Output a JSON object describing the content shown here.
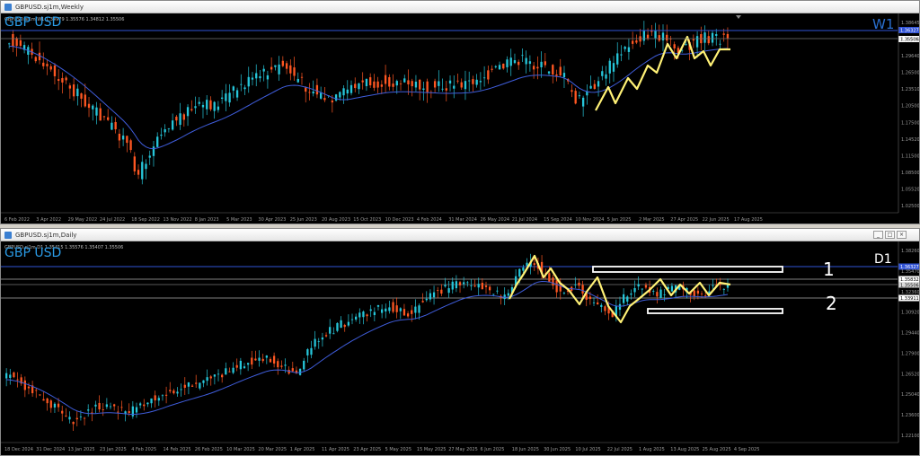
{
  "weekly": {
    "title": "GBPUSD.sj1m,Weekly",
    "symbol": "GBP USD",
    "ohlc": "GBPUSD.sj1m,W1  1.34979 1.35576 1.34812 1.35506",
    "timeframe": "W1",
    "price_tags": [
      "1.36327",
      "1.35506"
    ],
    "y_ticks": [
      "1.38645",
      "1.32630",
      "1.29640",
      "1.26500",
      "1.23510",
      "1.20500",
      "1.17500",
      "1.14520",
      "1.11500",
      "1.08500",
      "1.05520",
      "1.02500"
    ],
    "x_ticks": [
      "6 Feb 2022",
      "3 Apr 2022",
      "29 May 2022",
      "24 Jul 2022",
      "18 Sep 2022",
      "13 Nov 2022",
      "8 Jan 2023",
      "5 Mar 2023",
      "30 Apr 2023",
      "25 Jun 2023",
      "20 Aug 2023",
      "15 Oct 2023",
      "10 Dec 2023",
      "4 Feb 2024",
      "31 Mar 2024",
      "26 May 2024",
      "21 Jul 2024",
      "15 Sep 2024",
      "10 Nov 2024",
      "5 Jan 2025",
      "2 Mar 2025",
      "27 Apr 2025",
      "22 Jun 2025",
      "17 Aug 2025"
    ]
  },
  "daily": {
    "title": "GBPUSD.sj1m,Daily",
    "symbol": "GBP USD",
    "ohlc": "GBPUSD.sj1m,D1  1.35415 1.35576 1.35407 1.35506",
    "timeframe": "D1",
    "annotations": [
      "1",
      "2"
    ],
    "price_tags": [
      "1.36327",
      "1.35832",
      "1.35506",
      "1.33911"
    ],
    "y_ticks": [
      "1.38260",
      "1.35470",
      "1.32360",
      "1.30920",
      "1.29440",
      "1.27900",
      "1.26520",
      "1.25040",
      "1.23600",
      "1.22100"
    ],
    "x_ticks": [
      "18 Dec 2024",
      "31 Dec 2024",
      "13 Jan 2025",
      "23 Jan 2025",
      "4 Feb 2025",
      "14 Feb 2025",
      "26 Feb 2025",
      "10 Mar 2025",
      "20 Mar 2025",
      "1 Apr 2025",
      "11 Apr 2025",
      "23 Apr 2025",
      "5 May 2025",
      "15 May 2025",
      "27 May 2025",
      "6 Jun 2025",
      "18 Jun 2025",
      "30 Jun 2025",
      "10 Jul 2025",
      "22 Jul 2025",
      "1 Aug 2025",
      "13 Aug 2025",
      "25 Aug 2025",
      "4 Sep 2025"
    ]
  },
  "window_controls": [
    "_",
    "□",
    "×"
  ],
  "colors": {
    "bull": "#26c6da",
    "bear": "#ff5722",
    "ma": "#3f5ddb",
    "zigzag": "#fff176",
    "symbol": "#2a9be6"
  }
}
